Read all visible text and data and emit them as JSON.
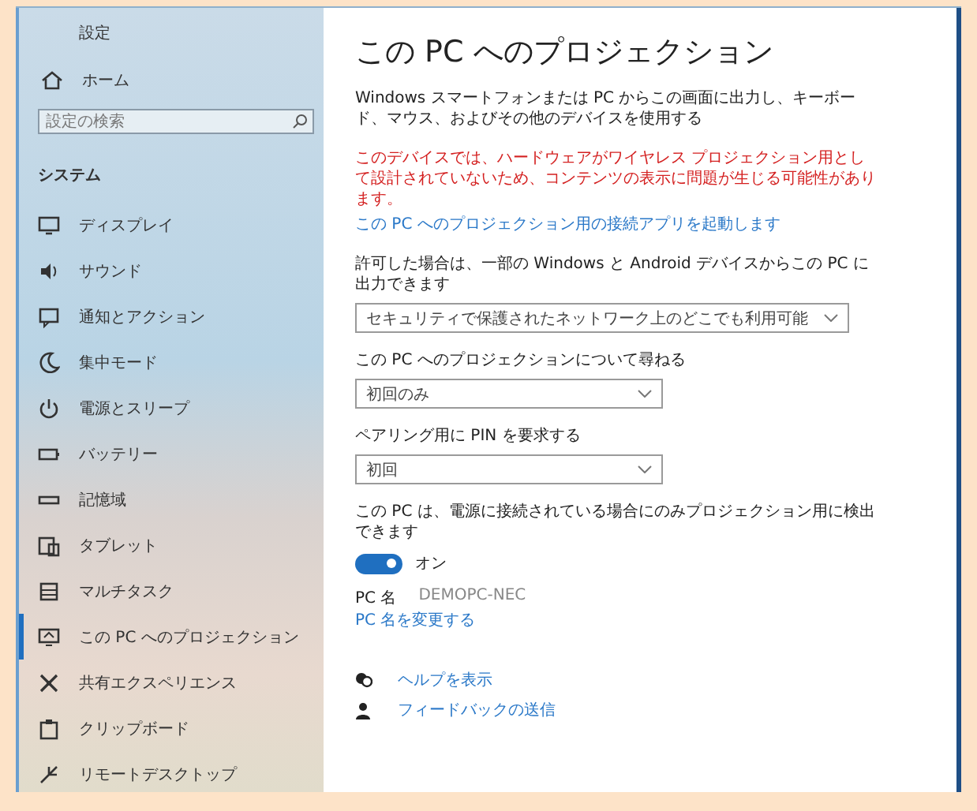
{
  "window": {
    "title": "設定"
  },
  "sidebar": {
    "home": "ホーム",
    "search": {
      "placeholder": "設定の検索"
    },
    "section": "システム",
    "items": [
      {
        "label": "ディスプレイ",
        "selected": false
      },
      {
        "label": "サウンド",
        "selected": false
      },
      {
        "label": "通知とアクション",
        "selected": false
      },
      {
        "label": "集中モード",
        "selected": false
      },
      {
        "label": "電源とスリープ",
        "selected": false
      },
      {
        "label": "バッテリー",
        "selected": false
      },
      {
        "label": "記憶域",
        "selected": false
      },
      {
        "label": "タブレット",
        "selected": false
      },
      {
        "label": "マルチタスク",
        "selected": false
      },
      {
        "label": "この PC へのプロジェクション",
        "selected": true
      },
      {
        "label": "共有エクスペリエンス",
        "selected": false
      },
      {
        "label": "クリップボード",
        "selected": false
      },
      {
        "label": "リモートデスクトップ",
        "selected": false
      }
    ]
  },
  "main": {
    "title": "この PC へのプロジェクション",
    "description": "Windows スマートフォンまたは PC からこの画面に出力し、キーボード、マウス、およびその他のデバイスを使用する",
    "warning": "このデバイスでは、ハードウェアがワイヤレス プロジェクション用として設計されていないため、コンテンツの表示に問題が生じる可能性があります。",
    "install_link": "この PC へのプロジェクション用の接続アプリを起動します",
    "settings": [
      {
        "label": "許可した場合は、一部の Windows と Android デバイスからこの PC に出力できます",
        "value": "セキュリティで保護されたネットワーク上のどこでも利用可能"
      },
      {
        "label": "この PC へのプロジェクションについて尋ねる",
        "value": "初回のみ"
      },
      {
        "label": "ペアリング用に PIN を要求する",
        "value": "初回"
      }
    ],
    "power_setting": {
      "label": "この PC は、電源に接続されている場合にのみプロジェクション用に検出できます",
      "on": true,
      "state_text": "オン"
    },
    "pc_name": {
      "label": "PC 名",
      "value": "DEMOPC-NEC"
    },
    "rename_link": "PC 名を変更する",
    "help_links": [
      "ヘルプを表示",
      "フィードバックの送信"
    ]
  }
}
